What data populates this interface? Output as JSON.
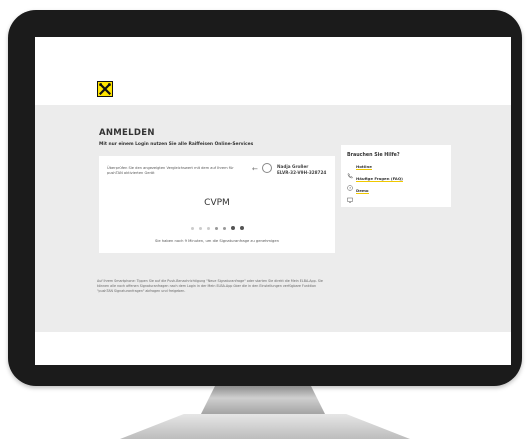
{
  "login": {
    "title": "ANMELDEN",
    "subtitle": "Mit nur einem Login nutzen Sie alle Raiffeisen Online-Services",
    "instruction": "Überprüfen Sie den angezeigten Vergleichswert mit dem auf Ihrem für pushTAN aktivierten Gerät",
    "user_name": "Nadja Großer",
    "user_code": "ELVR-32-V9H-328724",
    "comparison_code": "CVPM",
    "timer_text": "Sie haben noch 9 Minuten, um die Signaturanfrage zu genehmigen",
    "progress_step": 5,
    "progress_total": 7,
    "note": "Auf Ihrem Smartphone: Tippen Sie auf die Push-Benachrichtigung \"Neue Signaturanfrage\" oder starten Sie direkt die Mein ELBA-App. Sie können alle noch offenen Signaturanfragen nach dem Login in der Mein ELBA-App über die in den Einstellungen verfügbare Funktion \"pushTAN Signaturanfragen\" abfragen und freigeben."
  },
  "help": {
    "title": "Brauchen Sie Hilfe?",
    "items": [
      {
        "label": "Hotline",
        "icon": "phone-icon"
      },
      {
        "label": "Häufige Fragen (FAQ)",
        "icon": "question-icon"
      },
      {
        "label": "Demo",
        "icon": "screen-icon"
      }
    ]
  },
  "colors": {
    "brand": "#ffe400",
    "background": "#ececec",
    "bezel": "#1b1b1b"
  }
}
